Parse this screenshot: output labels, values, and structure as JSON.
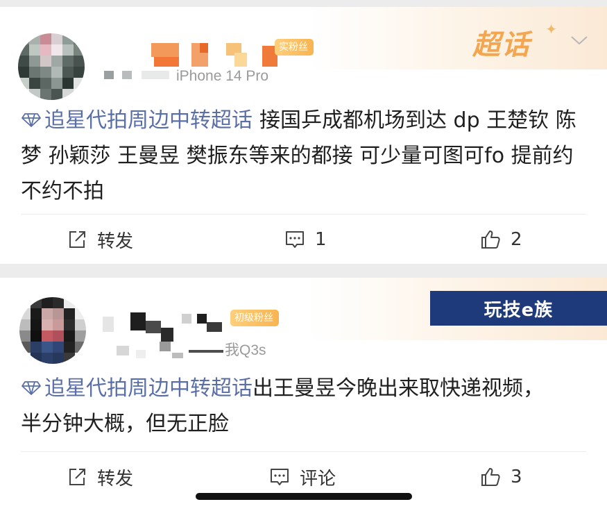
{
  "posts": [
    {
      "badge": "实粉丝",
      "device": "iPhone 14 Pro",
      "topic": "追星代拍周边中转超话",
      "body": "接国乒成都机场到达 dp 王楚钦 陈梦 孙颖莎 王曼昱 樊振东等来的都接 可少量可图可fo 提前约 不约不拍",
      "header_label": "超话",
      "actions": {
        "repost": "转发",
        "comment": "1",
        "like": "2"
      }
    },
    {
      "badge": "初级粉丝",
      "device": "我Q3s",
      "topic": "追星代拍周边中转超话",
      "body": "出王曼昱今晚出来取快递视频，半分钟大概，但无正脸",
      "watermark": "玩技e族",
      "actions": {
        "repost": "转发",
        "comment": "评论",
        "like": "3"
      }
    }
  ],
  "colors": {
    "topic": "#5a6fa8",
    "accent": "#f3a64f",
    "watermark_bg": "#1e3a7a"
  }
}
